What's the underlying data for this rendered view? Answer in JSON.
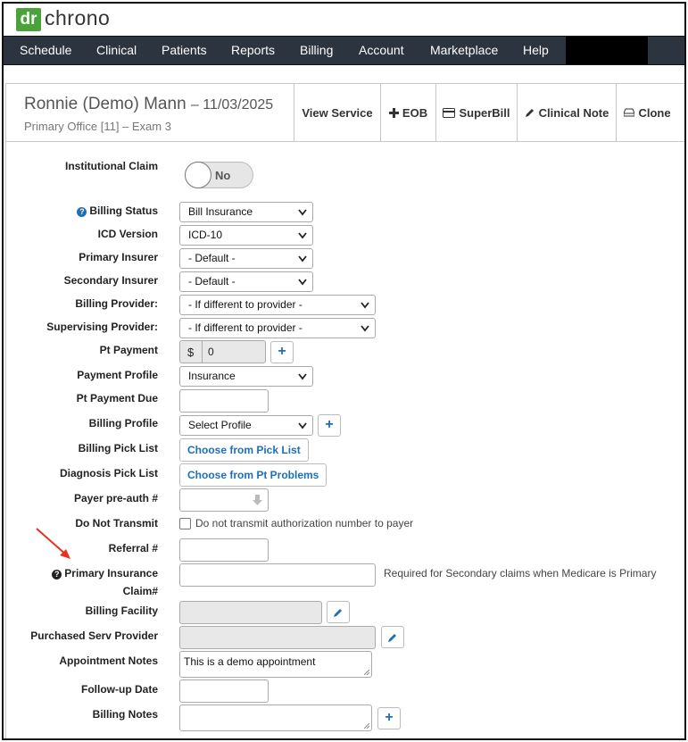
{
  "logo": {
    "dr": "dr",
    "chrono": "chrono"
  },
  "nav": {
    "items": [
      "Schedule",
      "Clinical",
      "Patients",
      "Reports",
      "Billing",
      "Account",
      "Marketplace",
      "Help"
    ]
  },
  "patient": {
    "name": "Ronnie (Demo) Mann",
    "date": "– 11/03/2025",
    "office": "Primary Office [11] – Exam 3"
  },
  "actions": {
    "view_service": "View Service",
    "eob": "EOB",
    "superbill": "SuperBill",
    "clinical_note": "Clinical Note",
    "clone": "Clone"
  },
  "form": {
    "institutional_claim": {
      "label": "Institutional Claim",
      "value": "No"
    },
    "billing_status": {
      "label": "Billing Status",
      "value": "Bill Insurance"
    },
    "icd_version": {
      "label": "ICD Version",
      "value": "ICD-10"
    },
    "primary_insurer": {
      "label": "Primary Insurer",
      "value": "- Default -"
    },
    "secondary_insurer": {
      "label": "Secondary Insurer",
      "value": "- Default -"
    },
    "billing_provider": {
      "label": "Billing Provider:",
      "value": "- If different to provider -"
    },
    "supervising_provider": {
      "label": "Supervising Provider:",
      "value": "- If different to provider -"
    },
    "pt_payment": {
      "label": "Pt Payment",
      "currency": "$",
      "value": "0"
    },
    "payment_profile": {
      "label": "Payment Profile",
      "value": "Insurance"
    },
    "pt_payment_due": {
      "label": "Pt Payment Due",
      "value": ""
    },
    "billing_profile": {
      "label": "Billing Profile",
      "value": "Select Profile"
    },
    "billing_pick_list": {
      "label": "Billing Pick List",
      "button": "Choose from Pick List"
    },
    "diagnosis_pick_list": {
      "label": "Diagnosis Pick List",
      "button": "Choose from Pt Problems"
    },
    "payer_preauth": {
      "label": "Payer pre-auth #",
      "value": ""
    },
    "do_not_transmit": {
      "label": "Do Not Transmit",
      "checkbox_text": "Do not transmit authorization number to payer",
      "checked": false
    },
    "referral": {
      "label": "Referral #",
      "value": ""
    },
    "primary_insurance_claim": {
      "label_line1": "Primary Insurance",
      "label_line2": "Claim#",
      "value": "",
      "hint": "Required for Secondary claims when Medicare is Primary"
    },
    "billing_facility": {
      "label": "Billing Facility",
      "value": ""
    },
    "purchased_serv_provider": {
      "label": "Purchased Serv Provider",
      "value": ""
    },
    "appointment_notes": {
      "label": "Appointment Notes",
      "value": "This is a demo appointment"
    },
    "followup_date": {
      "label": "Follow-up Date",
      "value": ""
    },
    "billing_notes": {
      "label": "Billing Notes",
      "value": ""
    }
  },
  "colors": {
    "nav_bg": "#2c3440",
    "logo_green": "#4aa33a",
    "link_blue": "#1d6fb8",
    "arrow_red": "#e8301f"
  }
}
